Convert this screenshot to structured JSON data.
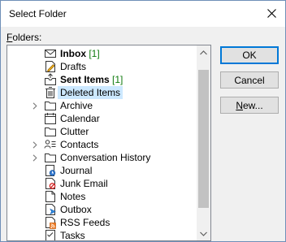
{
  "window": {
    "title": "Select Folder"
  },
  "folders_label": {
    "accel": "F",
    "rest": "olders:"
  },
  "tree": [
    {
      "label": "Inbox",
      "count": "[1]",
      "bold": true,
      "icon": "inbox-icon",
      "expander": false
    },
    {
      "label": "Drafts",
      "count": "",
      "bold": false,
      "icon": "drafts-icon",
      "expander": false
    },
    {
      "label": "Sent Items",
      "count": "[1]",
      "bold": true,
      "icon": "sent-items-icon",
      "expander": false
    },
    {
      "label": "Deleted Items",
      "count": "",
      "bold": false,
      "icon": "trash-icon",
      "expander": false,
      "selected": true
    },
    {
      "label": "Archive",
      "count": "",
      "bold": false,
      "icon": "folder-icon",
      "expander": true
    },
    {
      "label": "Calendar",
      "count": "",
      "bold": false,
      "icon": "calendar-icon",
      "expander": false
    },
    {
      "label": "Clutter",
      "count": "",
      "bold": false,
      "icon": "folder-icon",
      "expander": false
    },
    {
      "label": "Contacts",
      "count": "",
      "bold": false,
      "icon": "contacts-icon",
      "expander": true
    },
    {
      "label": "Conversation History",
      "count": "",
      "bold": false,
      "icon": "folder-icon",
      "expander": true
    },
    {
      "label": "Journal",
      "count": "",
      "bold": false,
      "icon": "journal-icon",
      "expander": false
    },
    {
      "label": "Junk Email",
      "count": "",
      "bold": false,
      "icon": "junk-email-icon",
      "expander": false
    },
    {
      "label": "Notes",
      "count": "",
      "bold": false,
      "icon": "notes-icon",
      "expander": false
    },
    {
      "label": "Outbox",
      "count": "",
      "bold": false,
      "icon": "outbox-icon",
      "expander": false
    },
    {
      "label": "RSS Feeds",
      "count": "",
      "bold": false,
      "icon": "rss-feeds-icon",
      "expander": false
    },
    {
      "label": "Tasks",
      "count": "",
      "bold": false,
      "icon": "tasks-icon",
      "expander": false
    }
  ],
  "buttons": {
    "ok": "OK",
    "cancel": "Cancel",
    "new_accel": "N",
    "new_rest": "ew..."
  },
  "colors": {
    "selection": "#cce8ff",
    "count": "#0e7a0d",
    "primary_border": "#0078d7"
  }
}
